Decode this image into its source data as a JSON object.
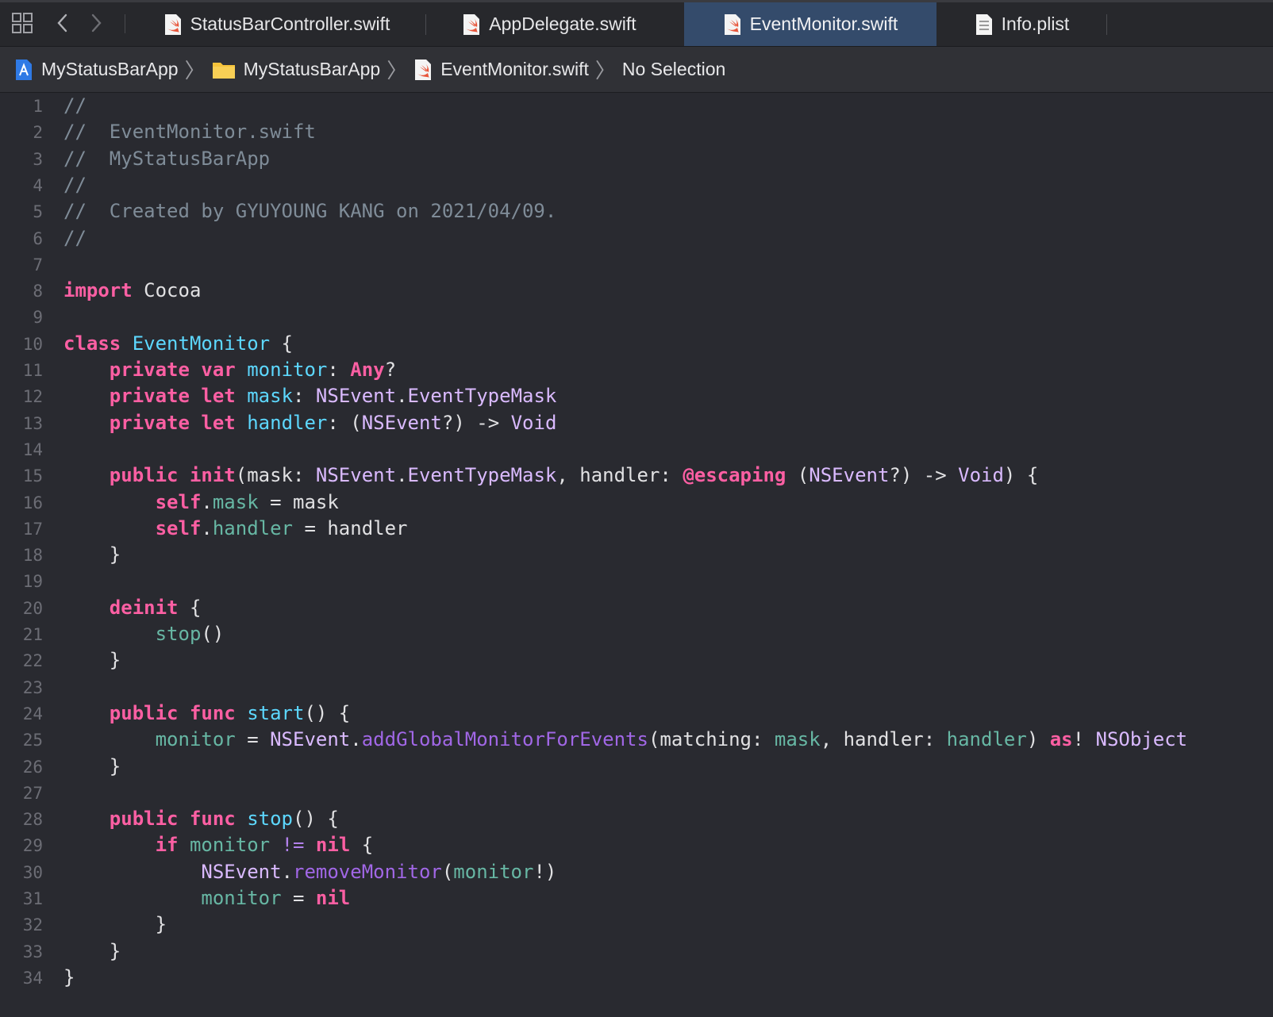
{
  "tabbar": {
    "tabs": [
      {
        "label": "StatusBarController.swift",
        "icon": "swift-file-icon",
        "active": false
      },
      {
        "label": "AppDelegate.swift",
        "icon": "swift-file-icon",
        "active": false
      },
      {
        "label": "EventMonitor.swift",
        "icon": "swift-file-icon",
        "active": true
      },
      {
        "label": "Info.plist",
        "icon": "plist-file-icon",
        "active": false
      }
    ]
  },
  "breadcrumb": {
    "project": "MyStatusBarApp",
    "folder": "MyStatusBarApp",
    "file": "EventMonitor.swift",
    "selection": "No Selection"
  },
  "editor": {
    "lines": [
      [
        {
          "t": "//",
          "c": "comment"
        }
      ],
      [
        {
          "t": "//  EventMonitor.swift",
          "c": "comment"
        }
      ],
      [
        {
          "t": "//  MyStatusBarApp",
          "c": "comment"
        }
      ],
      [
        {
          "t": "//",
          "c": "comment"
        }
      ],
      [
        {
          "t": "//  Created by GYUYOUNG KANG on 2021/04/09.",
          "c": "comment"
        }
      ],
      [
        {
          "t": "//",
          "c": "comment"
        }
      ],
      [],
      [
        {
          "t": "import",
          "c": "keyword"
        },
        {
          "t": " Cocoa",
          "c": "plain"
        }
      ],
      [],
      [
        {
          "t": "class",
          "c": "keyword"
        },
        {
          "t": " ",
          "c": "plain"
        },
        {
          "t": "EventMonitor",
          "c": "decl"
        },
        {
          "t": " {",
          "c": "plain"
        }
      ],
      [
        {
          "t": "    ",
          "c": "plain"
        },
        {
          "t": "private",
          "c": "keyword"
        },
        {
          "t": " ",
          "c": "plain"
        },
        {
          "t": "var",
          "c": "keyword"
        },
        {
          "t": " ",
          "c": "plain"
        },
        {
          "t": "monitor",
          "c": "decl"
        },
        {
          "t": ": ",
          "c": "plain"
        },
        {
          "t": "Any",
          "c": "keyword"
        },
        {
          "t": "?",
          "c": "plain"
        }
      ],
      [
        {
          "t": "    ",
          "c": "plain"
        },
        {
          "t": "private",
          "c": "keyword"
        },
        {
          "t": " ",
          "c": "plain"
        },
        {
          "t": "let",
          "c": "keyword"
        },
        {
          "t": " ",
          "c": "plain"
        },
        {
          "t": "mask",
          "c": "decl"
        },
        {
          "t": ": ",
          "c": "plain"
        },
        {
          "t": "NSEvent",
          "c": "type"
        },
        {
          "t": ".",
          "c": "plain"
        },
        {
          "t": "EventTypeMask",
          "c": "type"
        }
      ],
      [
        {
          "t": "    ",
          "c": "plain"
        },
        {
          "t": "private",
          "c": "keyword"
        },
        {
          "t": " ",
          "c": "plain"
        },
        {
          "t": "let",
          "c": "keyword"
        },
        {
          "t": " ",
          "c": "plain"
        },
        {
          "t": "handler",
          "c": "decl"
        },
        {
          "t": ": (",
          "c": "plain"
        },
        {
          "t": "NSEvent",
          "c": "type"
        },
        {
          "t": "?) -> ",
          "c": "plain"
        },
        {
          "t": "Void",
          "c": "type"
        }
      ],
      [],
      [
        {
          "t": "    ",
          "c": "plain"
        },
        {
          "t": "public",
          "c": "keyword"
        },
        {
          "t": " ",
          "c": "plain"
        },
        {
          "t": "init",
          "c": "keyword"
        },
        {
          "t": "(mask: ",
          "c": "plain"
        },
        {
          "t": "NSEvent",
          "c": "type"
        },
        {
          "t": ".",
          "c": "plain"
        },
        {
          "t": "EventTypeMask",
          "c": "type"
        },
        {
          "t": ", handler: ",
          "c": "plain"
        },
        {
          "t": "@escaping",
          "c": "keyword"
        },
        {
          "t": " (",
          "c": "plain"
        },
        {
          "t": "NSEvent",
          "c": "type"
        },
        {
          "t": "?) -> ",
          "c": "plain"
        },
        {
          "t": "Void",
          "c": "type"
        },
        {
          "t": ") {",
          "c": "plain"
        }
      ],
      [
        {
          "t": "        ",
          "c": "plain"
        },
        {
          "t": "self",
          "c": "keyword"
        },
        {
          "t": ".",
          "c": "plain"
        },
        {
          "t": "mask",
          "c": "prop"
        },
        {
          "t": " = mask",
          "c": "plain"
        }
      ],
      [
        {
          "t": "        ",
          "c": "plain"
        },
        {
          "t": "self",
          "c": "keyword"
        },
        {
          "t": ".",
          "c": "plain"
        },
        {
          "t": "handler",
          "c": "prop"
        },
        {
          "t": " = handler",
          "c": "plain"
        }
      ],
      [
        {
          "t": "    }",
          "c": "plain"
        }
      ],
      [],
      [
        {
          "t": "    ",
          "c": "plain"
        },
        {
          "t": "deinit",
          "c": "keyword"
        },
        {
          "t": " {",
          "c": "plain"
        }
      ],
      [
        {
          "t": "        ",
          "c": "plain"
        },
        {
          "t": "stop",
          "c": "prop"
        },
        {
          "t": "()",
          "c": "plain"
        }
      ],
      [
        {
          "t": "    }",
          "c": "plain"
        }
      ],
      [],
      [
        {
          "t": "    ",
          "c": "plain"
        },
        {
          "t": "public",
          "c": "keyword"
        },
        {
          "t": " ",
          "c": "plain"
        },
        {
          "t": "func",
          "c": "keyword"
        },
        {
          "t": " ",
          "c": "plain"
        },
        {
          "t": "start",
          "c": "decl"
        },
        {
          "t": "() {",
          "c": "plain"
        }
      ],
      [
        {
          "t": "        ",
          "c": "plain"
        },
        {
          "t": "monitor",
          "c": "prop"
        },
        {
          "t": " = ",
          "c": "plain"
        },
        {
          "t": "NSEvent",
          "c": "type"
        },
        {
          "t": ".",
          "c": "plain"
        },
        {
          "t": "addGlobalMonitorForEvents",
          "c": "method"
        },
        {
          "t": "(matching: ",
          "c": "plain"
        },
        {
          "t": "mask",
          "c": "prop"
        },
        {
          "t": ", handler: ",
          "c": "plain"
        },
        {
          "t": "handler",
          "c": "prop"
        },
        {
          "t": ") ",
          "c": "plain"
        },
        {
          "t": "as",
          "c": "keyword"
        },
        {
          "t": "! ",
          "c": "plain"
        },
        {
          "t": "NSObject",
          "c": "type"
        }
      ],
      [
        {
          "t": "    }",
          "c": "plain"
        }
      ],
      [],
      [
        {
          "t": "    ",
          "c": "plain"
        },
        {
          "t": "public",
          "c": "keyword"
        },
        {
          "t": " ",
          "c": "plain"
        },
        {
          "t": "func",
          "c": "keyword"
        },
        {
          "t": " ",
          "c": "plain"
        },
        {
          "t": "stop",
          "c": "decl"
        },
        {
          "t": "() {",
          "c": "plain"
        }
      ],
      [
        {
          "t": "        ",
          "c": "plain"
        },
        {
          "t": "if",
          "c": "keyword"
        },
        {
          "t": " ",
          "c": "plain"
        },
        {
          "t": "monitor",
          "c": "prop"
        },
        {
          "t": " ",
          "c": "plain"
        },
        {
          "t": "!=",
          "c": "method2"
        },
        {
          "t": " ",
          "c": "plain"
        },
        {
          "t": "nil",
          "c": "keyword"
        },
        {
          "t": " {",
          "c": "plain"
        }
      ],
      [
        {
          "t": "            ",
          "c": "plain"
        },
        {
          "t": "NSEvent",
          "c": "type"
        },
        {
          "t": ".",
          "c": "plain"
        },
        {
          "t": "removeMonitor",
          "c": "method"
        },
        {
          "t": "(",
          "c": "plain"
        },
        {
          "t": "monitor",
          "c": "prop"
        },
        {
          "t": "!)",
          "c": "plain"
        }
      ],
      [
        {
          "t": "            ",
          "c": "plain"
        },
        {
          "t": "monitor",
          "c": "prop"
        },
        {
          "t": " = ",
          "c": "plain"
        },
        {
          "t": "nil",
          "c": "keyword"
        }
      ],
      [
        {
          "t": "        }",
          "c": "plain"
        }
      ],
      [
        {
          "t": "    }",
          "c": "plain"
        }
      ],
      [
        {
          "t": "}",
          "c": "plain"
        }
      ]
    ]
  },
  "colors": {
    "background": "#292a30",
    "active_tab": "#344b6b",
    "keyword": "#fc5fa3",
    "type": "#dabaff",
    "declaration": "#5dd8ff",
    "property": "#67b7a4",
    "method": "#a167e6",
    "comment": "#7f8c98"
  }
}
